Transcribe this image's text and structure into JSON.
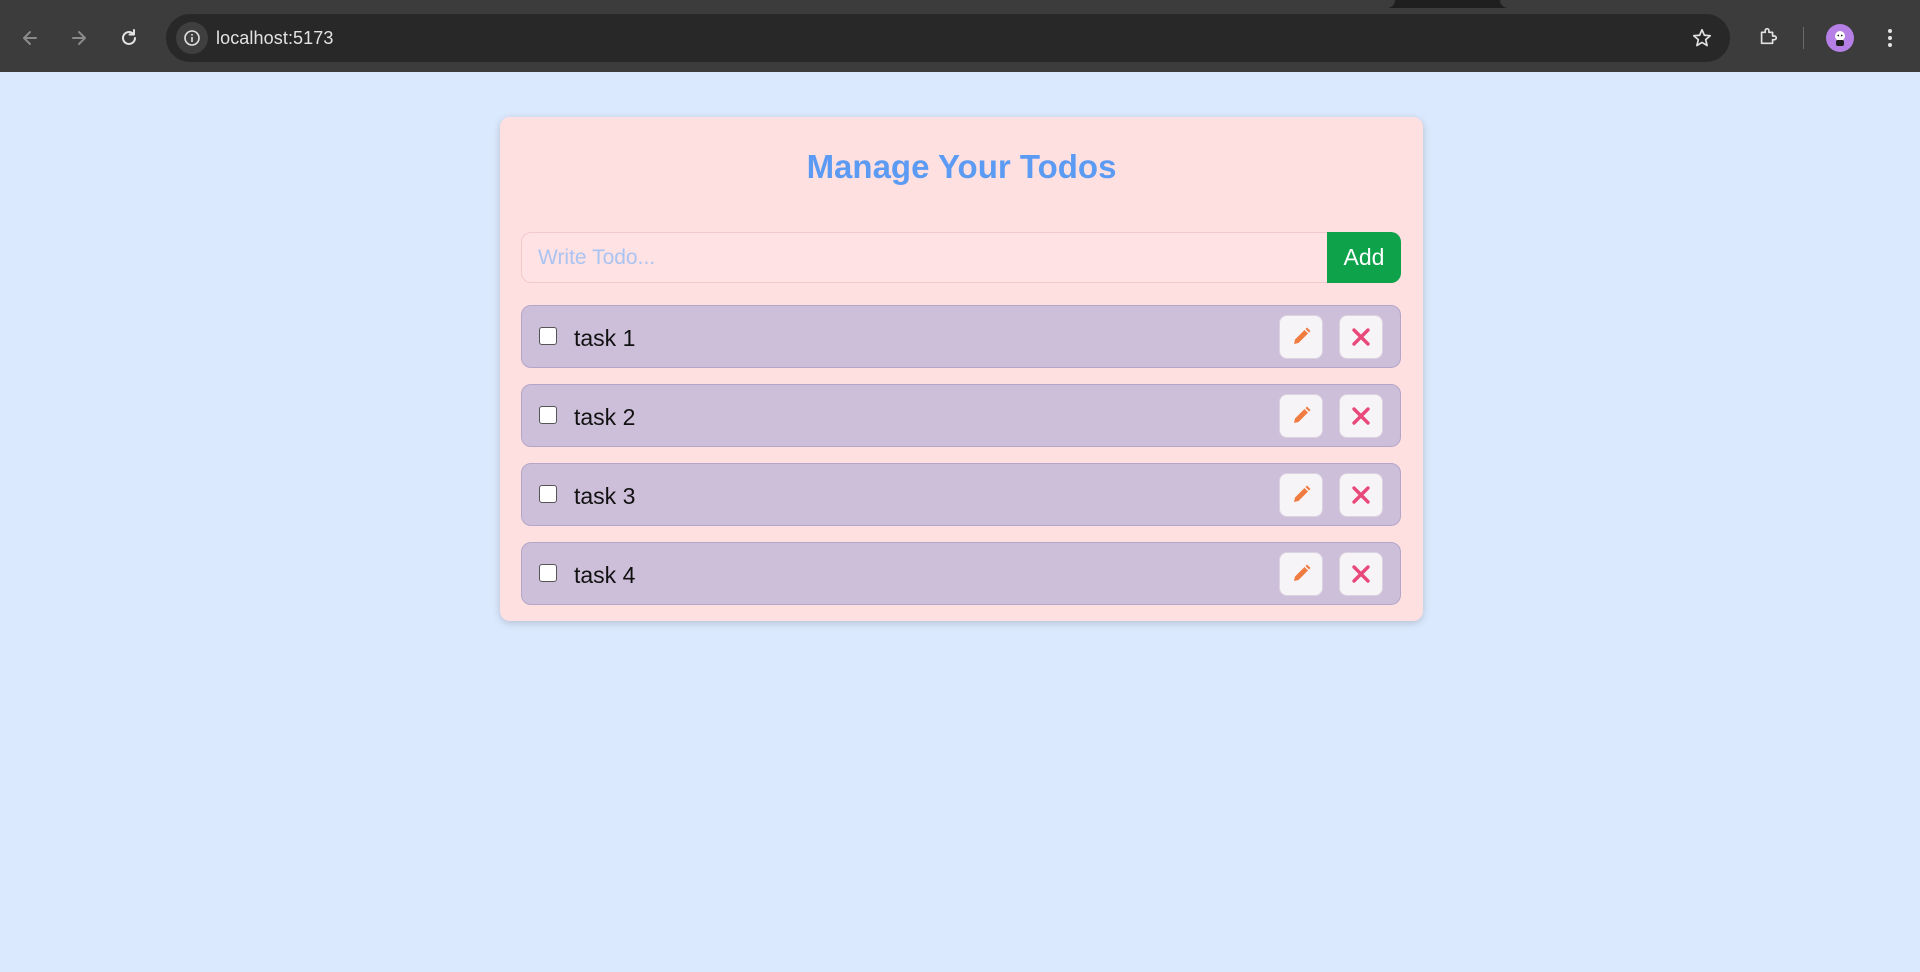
{
  "browser": {
    "url": "localhost:5173"
  },
  "app": {
    "title": "Manage Your Todos",
    "input_placeholder": "Write Todo...",
    "input_value": "",
    "add_label": "Add",
    "todos": [
      {
        "text": "task 1",
        "completed": false
      },
      {
        "text": "task 2",
        "completed": false
      },
      {
        "text": "task 3",
        "completed": false
      },
      {
        "text": "task 4",
        "completed": false
      }
    ]
  },
  "colors": {
    "page_background": "#dbe9fe",
    "card_background": "#ffe0e1",
    "title": "#5b9bf3",
    "add_button": "#0ea34a",
    "todo_item": "#cdbfd9",
    "edit_icon": "#f07b3f",
    "delete_icon": "#e8497a"
  },
  "icons": {
    "edit": "pencil-icon",
    "delete": "close-icon"
  }
}
